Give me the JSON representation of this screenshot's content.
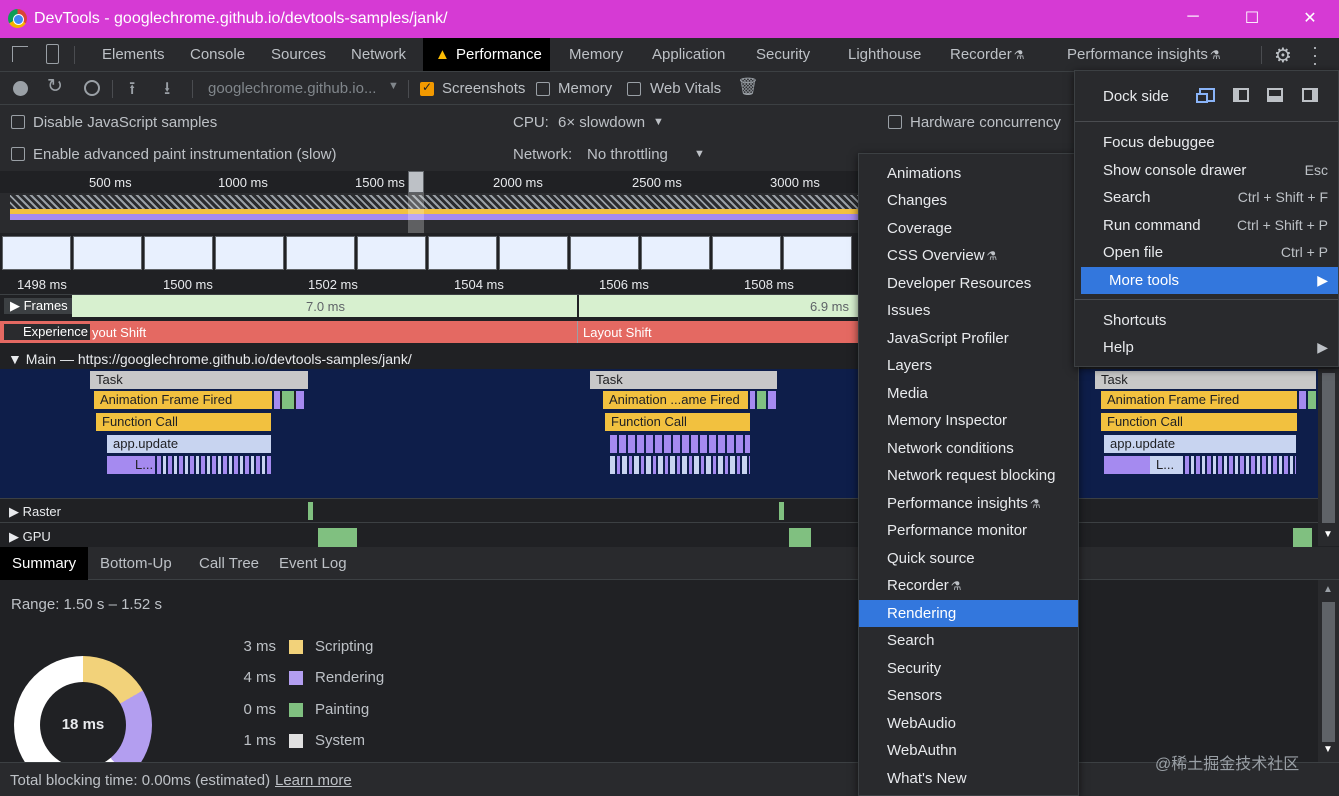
{
  "window": {
    "title": "DevTools - googlechrome.github.io/devtools-samples/jank/"
  },
  "tabs": [
    "Elements",
    "Console",
    "Sources",
    "Network",
    "Performance",
    "Memory",
    "Application",
    "Security",
    "Lighthouse",
    "Recorder",
    "Performance insights"
  ],
  "toolbar": {
    "url": "googlechrome.github.io...",
    "screenshots": "Screenshots",
    "memory": "Memory",
    "web_vitals": "Web Vitals"
  },
  "settings": {
    "disable_js": "Disable JavaScript samples",
    "advanced_paint": "Enable advanced paint instrumentation (slow)",
    "cpu_label": "CPU:",
    "cpu_value": "6× slowdown",
    "network_label": "Network:",
    "network_value": "No throttling",
    "hw_concurrency": "Hardware concurrency"
  },
  "ruler_top": [
    "500 ms",
    "1000 ms",
    "1500 ms",
    "2000 ms",
    "2500 ms",
    "3000 ms"
  ],
  "ruler_bottom": [
    "1498 ms",
    "1500 ms",
    "1502 ms",
    "1504 ms",
    "1506 ms",
    "1508 ms"
  ],
  "tracks": {
    "frames": "Frames",
    "frame1": "7.0 ms",
    "frame2": "6.9 ms",
    "experience": "Experience",
    "layout_shift_a": "yout Shift",
    "layout_shift_b": "Layout Shift",
    "main": "Main — https://googlechrome.github.io/devtools-samples/jank/",
    "raster": "Raster",
    "gpu": "GPU"
  },
  "flame": {
    "task": "Task",
    "anim": "Animation Frame Fired",
    "anim_short": "Animation ...ame Fired",
    "func": "Function Call",
    "update": "app.update",
    "l": "L..."
  },
  "bottom_tabs": [
    "Summary",
    "Bottom-Up",
    "Call Tree",
    "Event Log"
  ],
  "summary": {
    "range": "Range: 1.50 s – 1.52 s",
    "total": "18 ms",
    "legend": [
      {
        "ms": "3 ms",
        "name": "Scripting",
        "color": "#f2d27a"
      },
      {
        "ms": "4 ms",
        "name": "Rendering",
        "color": "#b39ef0"
      },
      {
        "ms": "0 ms",
        "name": "Painting",
        "color": "#80c080"
      },
      {
        "ms": "1 ms",
        "name": "System",
        "color": "#e0e0e0"
      }
    ]
  },
  "footer": {
    "tbt": "Total blocking time: 0.00ms (estimated)",
    "learn": "Learn more"
  },
  "more_tools": [
    "Animations",
    "Changes",
    "Coverage",
    "CSS Overview",
    "Developer Resources",
    "Issues",
    "JavaScript Profiler",
    "Layers",
    "Media",
    "Memory Inspector",
    "Network conditions",
    "Network request blocking",
    "Performance insights",
    "Performance monitor",
    "Quick source",
    "Recorder",
    "Rendering",
    "Search",
    "Security",
    "Sensors",
    "WebAudio",
    "WebAuthn",
    "What's New"
  ],
  "main_menu": {
    "dock_side": "Dock side",
    "focus": "Focus debuggee",
    "console_drawer": "Show console drawer",
    "console_sc": "Esc",
    "search": "Search",
    "search_sc": "Ctrl + Shift + F",
    "run": "Run command",
    "run_sc": "Ctrl + Shift + P",
    "open": "Open file",
    "open_sc": "Ctrl + P",
    "more_tools": "More tools",
    "shortcuts": "Shortcuts",
    "help": "Help"
  },
  "watermark": "@稀土掘金技术社区"
}
